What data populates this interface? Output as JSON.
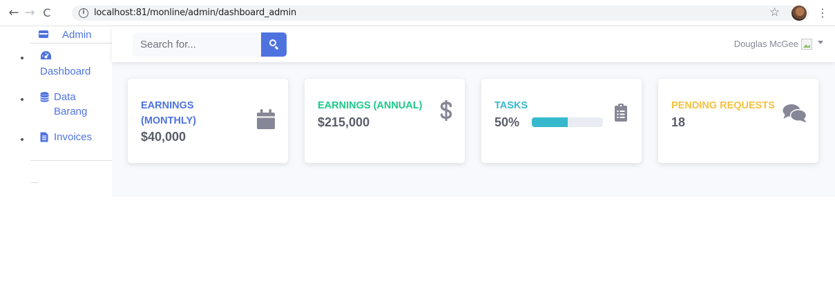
{
  "browser": {
    "back": "←",
    "forward": "→",
    "reload": "C",
    "url": "localhost:81/monline/admin/dashboard_admin",
    "star": "☆",
    "menu": "⋮"
  },
  "sidebar": {
    "brand": "Admin",
    "items": [
      {
        "label": "Dashboard",
        "icon": "tachometer-icon"
      },
      {
        "label": "Data Barang",
        "icon": "database-icon"
      },
      {
        "label": "Invoices",
        "icon": "file-invoice-icon"
      }
    ]
  },
  "topbar": {
    "search_placeholder": "Search for...",
    "user_name": "Douglas McGee"
  },
  "cards": [
    {
      "title": "EARNINGS (MONTHLY)",
      "value": "$40,000",
      "color": "#4e73df",
      "icon": "calendar-icon"
    },
    {
      "title": "EARNINGS (ANNUAL)",
      "value": "$215,000",
      "color": "#1cc88a",
      "icon": "dollar-icon"
    },
    {
      "title": "TASKS",
      "value": "50%",
      "color": "#36b9cc",
      "icon": "clipboard-list-icon",
      "progress": 0.5
    },
    {
      "title": "PENDING REQUESTS",
      "value": "18",
      "color": "#f6c23e",
      "icon": "comments-icon"
    }
  ]
}
